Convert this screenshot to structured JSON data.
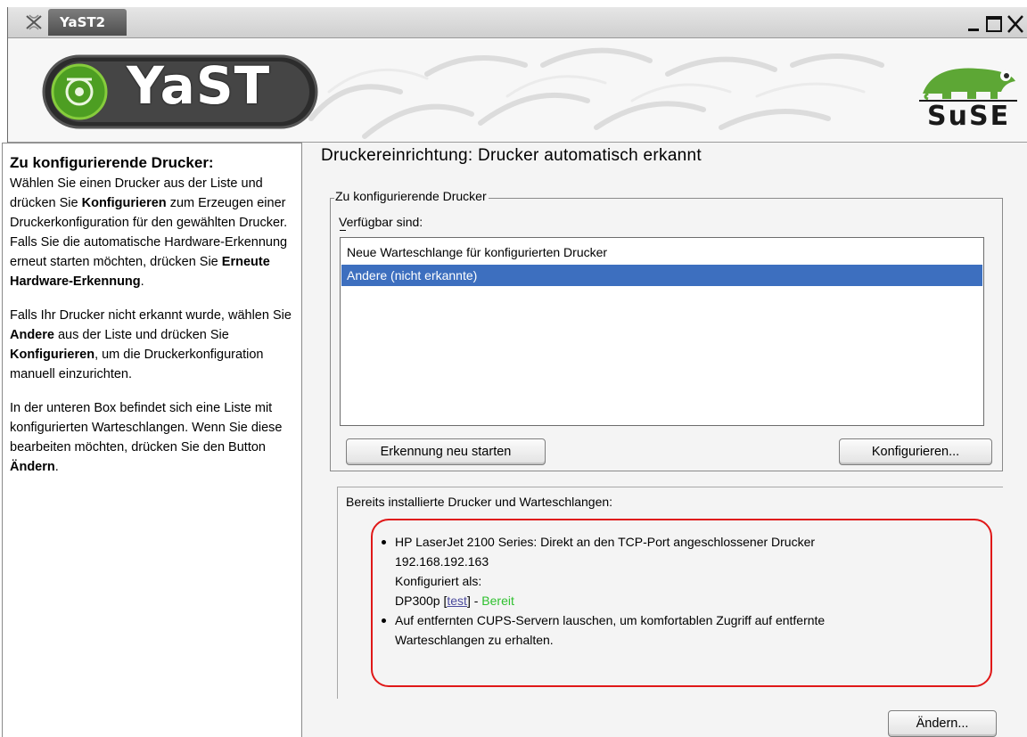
{
  "window": {
    "title": "YaST2",
    "controls": [
      "minimize-icon",
      "maximize-icon",
      "close-icon"
    ]
  },
  "banner": {
    "logo_text": "YaST",
    "vendor_logo_text": "SuSE"
  },
  "help": {
    "heading": "Zu konfigurierende Drucker:",
    "p1_a": "Wählen Sie einen Drucker aus der Liste und drücken Sie ",
    "p1_b": "Konfigurieren",
    "p1_c": " zum Erzeugen einer Druckerkonfiguration für den gewählten Drucker. Falls Sie die automatische Hardware-Erkennung erneut starten möchten, drücken Sie ",
    "p1_d": "Erneute Hardware-Erkennung",
    "p1_e": ".",
    "p2_a": "Falls Ihr Drucker nicht erkannt wurde, wählen Sie ",
    "p2_b": "Andere",
    "p2_c": " aus der Liste und drücken Sie ",
    "p2_d": "Konfigurieren",
    "p2_e": ", um die Druckerkonfiguration manuell einzurichten.",
    "p3_a": "In der unteren Box befindet sich eine Liste mit konfigurierten Warteschlangen. Wenn Sie diese bearbeiten möchten, drücken Sie den Button ",
    "p3_b": "Ändern",
    "p3_c": "."
  },
  "main": {
    "title": "Druckereinrichtung: Drucker automatisch erkannt",
    "group_title": "Zu konfigurierende Drucker",
    "available_label": "Verfügbar sind:",
    "list_items": [
      "Neue Warteschlange für konfigurierten Drucker",
      "Andere (nicht erkannte)"
    ],
    "selected_index": 1,
    "detect_button": "Erkennung neu starten",
    "configure_button": "Konfigurieren...",
    "installed_title": "Bereits installierte Drucker und Warteschlangen:",
    "installed": {
      "item1_line1": "HP LaserJet 2100 Series: Direkt an den TCP-Port angeschlossener Drucker",
      "item1_line2": "192.168.192.163",
      "item1_line3": "Konfiguriert als:",
      "item1_queue": "DP300p",
      "item1_test_link": "test",
      "item1_sep": " - ",
      "item1_status": "Bereit",
      "item2_line1": "Auf entfernten CUPS-Servern lauschen, um komfortablen Zugriff auf entfernte",
      "item2_line2": "Warteschlangen zu erhalten."
    },
    "change_button": "Ändern..."
  },
  "colors": {
    "selection": "#3d6fbf",
    "status_ready": "#2ec02e",
    "annotation": "#e01818"
  }
}
